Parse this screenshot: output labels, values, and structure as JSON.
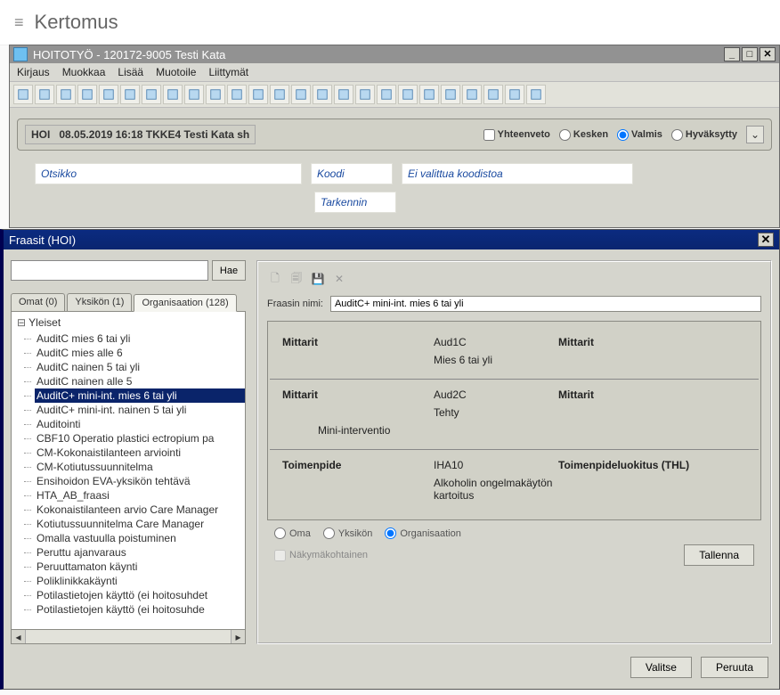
{
  "page": {
    "title": "Kertomus"
  },
  "window": {
    "title": "HOITOTYÖ - 120172-9005 Testi Kata",
    "menus": [
      "Kirjaus",
      "Muokkaa",
      "Lisää",
      "Muotoile",
      "Liittymät"
    ],
    "status": {
      "code": "HOI",
      "text": "08.05.2019 16:18 TKKE4 Testi Kata sh",
      "summary_label": "Yhteenveto",
      "states": {
        "kesken": "Kesken",
        "valmis": "Valmis",
        "hyvaksytty": "Hyväksytty",
        "selected": "valmis"
      }
    },
    "fields": {
      "otsikko": "Otsikko",
      "koodi": "Koodi",
      "eival": "Ei valittua koodistoa",
      "tarkennin": "Tarkennin"
    }
  },
  "dialog": {
    "title": "Fraasit (HOI)",
    "search_button": "Hae",
    "tabs": [
      {
        "label": "Omat (0)"
      },
      {
        "label": "Yksikön (1)"
      },
      {
        "label": "Organisaation (128)",
        "active": true
      }
    ],
    "tree": {
      "root": "Yleiset",
      "items": [
        "AuditC mies 6 tai yli",
        "AuditC mies alle 6",
        "AuditC nainen 5 tai yli",
        "AuditC nainen alle 5",
        "AuditC+ mini-int. mies 6 tai yli",
        "AuditC+ mini-int. nainen 5 tai yli",
        "Auditointi",
        "CBF10 Operatio plastici ectropium pa",
        "CM-Kokonaistilanteen arviointi",
        "CM-Kotiutussuunnitelma",
        "Ensihoidon EVA-yksikön tehtävä",
        "HTA_AB_fraasi",
        "Kokonaistilanteen arvio Care Manager",
        "Kotiutussuunnitelma Care Manager",
        "Omalla vastuulla poistuminen",
        "Peruttu ajanvaraus",
        "Peruuttamaton käynti",
        "Poliklinikkakäynti",
        "Potilastietojen käyttö (ei hoitosuhdet",
        "Potilastietojen käyttö (ei hoitosuhde"
      ],
      "selected": "AuditC+ mini-int. mies 6 tai yli"
    },
    "fraasi": {
      "name_label": "Fraasin nimi:",
      "name_value": "AuditC+ mini-int. mies 6 tai yli",
      "entries": [
        {
          "header": "Mittarit",
          "code": "Aud1C",
          "header_right": "Mittarit",
          "sub1": "Mies 6 tai yli",
          "sub2": ""
        },
        {
          "header": "Mittarit",
          "code": "Aud2C",
          "header_right": "Mittarit",
          "sub1": "Tehty",
          "sub2": "Mini-interventio"
        },
        {
          "header": "Toimenpide",
          "code": "IHA10",
          "header_right": "Toimenpideluokitus (THL)",
          "sub1": "Alkoholin ongelmakäytön kartoitus",
          "sub2": ""
        }
      ],
      "scope": {
        "oma": "Oma",
        "yksikon": "Yksikön",
        "organisaation": "Organisaation",
        "selected": "organisaation"
      },
      "viewspecific": "Näkymäkohtainen",
      "save": "Tallenna"
    },
    "footer": {
      "valitse": "Valitse",
      "peruuta": "Peruuta"
    }
  }
}
